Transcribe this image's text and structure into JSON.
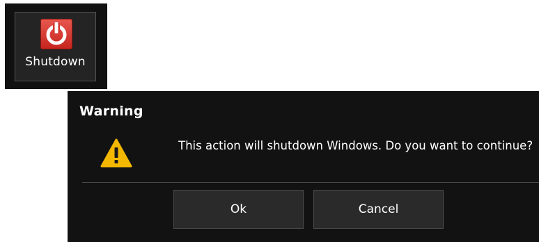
{
  "tile": {
    "label": "Shutdown",
    "icon": "power-icon",
    "icon_color": "#d9362c"
  },
  "dialog": {
    "title": "Warning",
    "icon": "warning-icon",
    "icon_color": "#f5b800",
    "message": "This action will shutdown Windows. Do you want to continue?",
    "buttons": {
      "ok_label": "Ok",
      "cancel_label": "Cancel"
    }
  }
}
